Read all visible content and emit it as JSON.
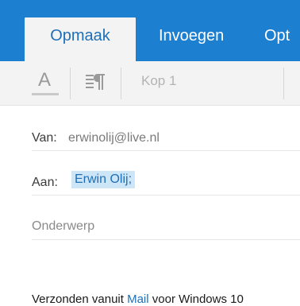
{
  "ribbon": {
    "tabs": [
      {
        "label": "Opmaak",
        "active": true
      },
      {
        "label": "Invoegen",
        "active": false
      },
      {
        "label": "Opt",
        "active": false
      }
    ],
    "accent_color": "#1d7fd0"
  },
  "toolbar": {
    "text_format_glyph": "A",
    "paragraph_icon": "paragraph-format-icon",
    "style_value": "Kop 1"
  },
  "message": {
    "from_label": "Van:",
    "from_value": "erwinolij@live.nl",
    "to_label": "Aan:",
    "to_value": "Erwin Olij;",
    "subject_placeholder": "Onderwerp",
    "body_prefix": "Verzonden vanuit ",
    "body_link": "Mail",
    "body_suffix": " voor Windows 10"
  }
}
